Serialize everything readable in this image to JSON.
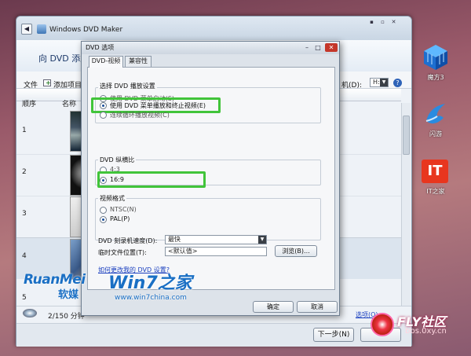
{
  "desktop": {
    "icons": [
      {
        "label": "魔方3",
        "icon": "cube-app-icon"
      },
      {
        "label": "闪游",
        "icon": "flash-browser-icon"
      },
      {
        "label": "IT之家",
        "icon": "it-home-icon"
      }
    ],
    "it_logo_text": "IT"
  },
  "maker": {
    "title": "Windows DVD Maker",
    "header_title": "向 DVD 添加",
    "toolbar": {
      "file": "文件",
      "add_items": "添加项目",
      "drive_label": "机(D):",
      "drive_value": "H:",
      "help": "?"
    },
    "columns": {
      "order": "顺序",
      "name": "名称"
    },
    "rows": [
      "1",
      "2",
      "3",
      "4",
      "5"
    ],
    "status": {
      "duration": "2/150 分钟",
      "options_link": "选项(O)"
    },
    "buttons": {
      "next": "下一步(N)"
    }
  },
  "dialog": {
    "title": "DVD 选项",
    "tabs": [
      "DVD-视频",
      "兼容性"
    ],
    "playback": {
      "group_label": "选择 DVD 播放设置",
      "options": [
        {
          "label": "使用 DVD 菜单启动(S)",
          "selected": false
        },
        {
          "label": "使用 DVD 菜单播放和终止视频(E)",
          "selected": true
        },
        {
          "label": "连续循环播放视频(C)",
          "selected": false
        }
      ]
    },
    "aspect": {
      "group_label": "DVD 纵横比",
      "options": [
        {
          "label": "4:3",
          "selected": false
        },
        {
          "label": "16:9",
          "selected": true
        }
      ]
    },
    "format": {
      "group_label": "视频格式",
      "options": [
        {
          "label": "NTSC(N)",
          "selected": false
        },
        {
          "label": "PAL(P)",
          "selected": true
        }
      ]
    },
    "burn_speed": {
      "label": "DVD 刻录机速度(D):",
      "value": "最快"
    },
    "temp_location": {
      "label": "临时文件位置(T):",
      "value": "<默认值>",
      "browse": "浏览(B)..."
    },
    "help_link": "如何更改我的 DVD 设置?",
    "ok": "确定",
    "cancel": "取消"
  },
  "watermarks": {
    "ruanmei": "RuanMei",
    "ruanmei_cn": "软媒",
    "win7": "Win7之家",
    "win7_url": "www.win7china.com",
    "fly": "FLY社区",
    "fly_url": "bbs.0xy.cn"
  }
}
